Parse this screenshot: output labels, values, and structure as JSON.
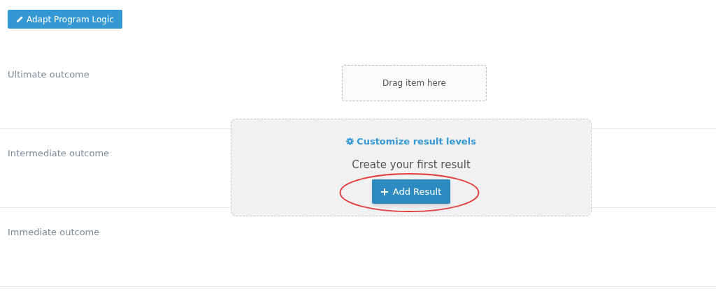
{
  "toolbar": {
    "button": "Adapt Program Logic"
  },
  "rows": [
    {
      "label": "Ultimate outcome"
    },
    {
      "label": "Intermediate outcome"
    },
    {
      "label": "Immediate outcome"
    }
  ],
  "drop_zone": {
    "text": "Drag item here"
  },
  "empty_panel": {
    "link": "Customize result levels",
    "message": "Create your first result",
    "button": "Add Result",
    "highlighted": true
  }
}
